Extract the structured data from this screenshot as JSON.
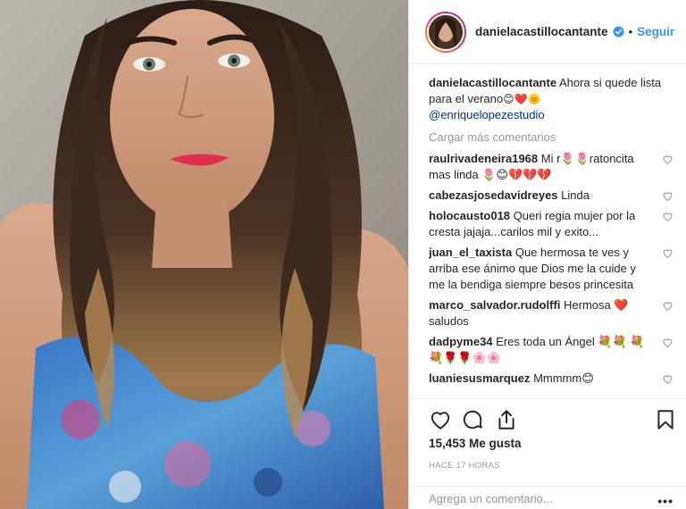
{
  "header": {
    "username": "danielacastillocantante",
    "separator": "•",
    "follow_label": "Seguir"
  },
  "caption": {
    "username": "danielacastillocantante",
    "text": "Ahora si quede lista para el verano",
    "emoji": "😊❤️🌞",
    "mention": "@enriquelopezestudio"
  },
  "load_more": "Cargar más comentarios",
  "comments": [
    {
      "user": "raulrivadeneira1968",
      "text": "Mi r🌷🌷ratoncita mas linda 🌷😊💔💔💔"
    },
    {
      "user": "cabezasjosedavidreyes",
      "text": "Linda"
    },
    {
      "user": "holocausto018",
      "text": "Queri regia mujer por la cresta jajaja...carilos mil y exito..."
    },
    {
      "user": "juan_el_taxista",
      "text": "Que hermosa te ves y arriba ese ánimo que Dios me la cuide y me la bendiga siempre besos princesita"
    },
    {
      "user": "marco_salvador.rudolffi",
      "text": "Hermosa ❤️ saludos"
    },
    {
      "user": "dadpyme34",
      "text": "Eres toda un Ángel 💐💐 💐💐🌹🌹🌸🌸"
    },
    {
      "user": "luaniesusmarquez",
      "text": "Mmmmm😊"
    }
  ],
  "likes": "15,453 Me gusta",
  "timestamp": "HACE 17 HORAS",
  "add_comment": {
    "placeholder": "Agrega un comentario...",
    "more": "•••"
  },
  "icons": [
    "heart-icon",
    "comment-icon",
    "share-icon",
    "bookmark-icon",
    "verified-icon"
  ],
  "colors": {
    "accent": "#3897f0",
    "heart": "#ed4956",
    "muted": "#999999",
    "text": "#262626"
  }
}
